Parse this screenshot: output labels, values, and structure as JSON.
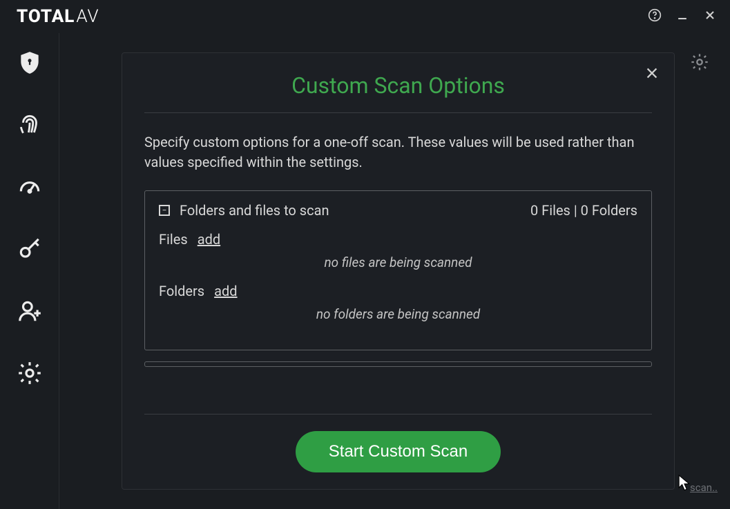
{
  "app": {
    "logo_bold": "TOTAL",
    "logo_light": "AV"
  },
  "modal": {
    "title": "Custom Scan Options",
    "description": "Specify custom options for a one-off scan. These values will be used rather than values specified within the settings.",
    "section_title": "Folders and files to scan",
    "file_count": 0,
    "folder_count": 0,
    "count_label": "0 Files | 0 Folders",
    "files_label": "Files",
    "files_add": "add",
    "files_empty": "no files are being scanned",
    "folders_label": "Folders",
    "folders_add": "add",
    "folders_empty": "no folders are being scanned",
    "start_button": "Start Custom Scan"
  },
  "footer": {
    "corner_text": "scan.."
  },
  "colors": {
    "accent_green": "#3fa84f",
    "button_green": "#2f9e44",
    "bg": "#1a1d21"
  }
}
